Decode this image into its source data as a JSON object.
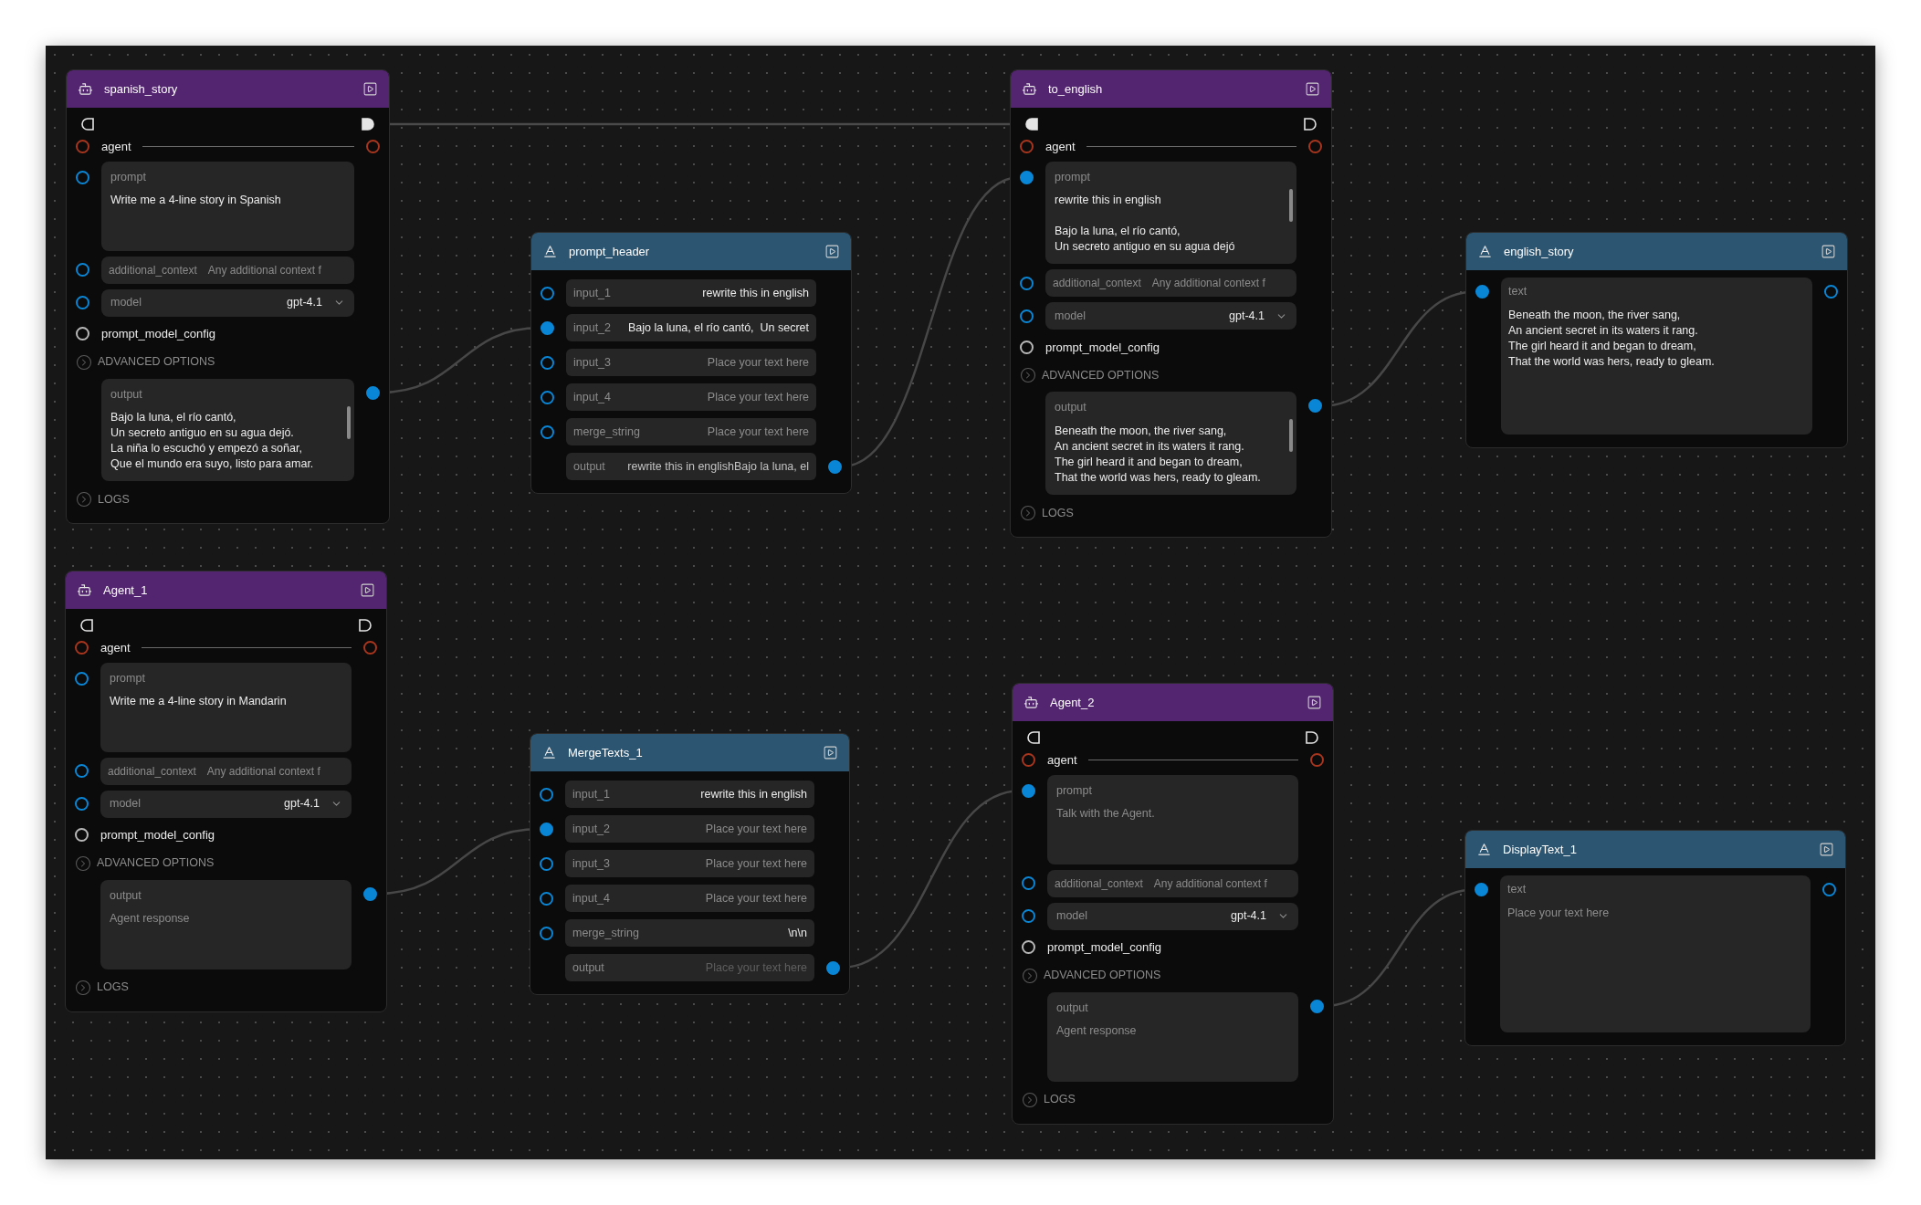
{
  "canvas": {
    "nodes": [
      {
        "kind": "agent",
        "title": "spanish_story",
        "flow_in": {
          "connected": false
        },
        "flow_out": {
          "connected": true
        },
        "agent": {
          "label": "agent",
          "in_connected": false,
          "out_connected": false
        },
        "prompt": {
          "label": "prompt",
          "lines": [
            "Write me a 4-line story in Spanish"
          ],
          "connected": false
        },
        "additional_context": {
          "label": "additional_context",
          "placeholder": "Any additional context f",
          "connected": false
        },
        "model": {
          "label": "model",
          "value": "gpt-4.1",
          "connected": false
        },
        "config": {
          "label": "prompt_model_config",
          "connected": false
        },
        "advanced": "ADVANCED OPTIONS",
        "output": {
          "label": "output",
          "lines": [
            "Bajo la luna, el río cantó,",
            "Un secreto antiguo en su agua dejó.",
            "La niña lo escuchó y empezó a soñar,",
            "Que el mundo era suyo, listo para amar."
          ],
          "connected": true
        },
        "logs": "LOGS"
      },
      {
        "kind": "merge",
        "title": "prompt_header",
        "fields": [
          {
            "label": "input_1",
            "value": "rewrite this in english",
            "connected": false
          },
          {
            "label": "input_2",
            "value": "Bajo la luna, el río cantó,  Un secret",
            "connected": true
          },
          {
            "label": "input_3",
            "placeholder": "Place your text here",
            "connected": false
          },
          {
            "label": "input_4",
            "placeholder": "Place your text here",
            "connected": false
          },
          {
            "label": "merge_string",
            "placeholder": "Place your text here",
            "connected": false
          }
        ],
        "output": {
          "label": "output",
          "value": "rewrite this in englishBajo la luna, el",
          "connected": true
        }
      },
      {
        "kind": "agent",
        "title": "to_english",
        "flow_in": {
          "connected": true
        },
        "flow_out": {
          "connected": false
        },
        "agent": {
          "label": "agent",
          "in_connected": false,
          "out_connected": false
        },
        "prompt": {
          "label": "prompt",
          "paragraphs": [
            [
              "rewrite this in english"
            ],
            [
              "Bajo la luna, el río cantó,",
              "Un secreto antiguo en su agua dejó"
            ]
          ],
          "connected": true
        },
        "additional_context": {
          "label": "additional_context",
          "placeholder": "Any additional context f",
          "connected": false
        },
        "model": {
          "label": "model",
          "value": "gpt-4.1",
          "connected": false
        },
        "config": {
          "label": "prompt_model_config",
          "connected": false
        },
        "advanced": "ADVANCED OPTIONS",
        "output": {
          "label": "output",
          "lines": [
            "Beneath the moon, the river sang,",
            "An ancient secret in its waters it rang.",
            "The girl heard it and began to dream,",
            "That the world was hers, ready to gleam."
          ],
          "connected": true
        },
        "logs": "LOGS"
      },
      {
        "kind": "display",
        "title": "english_story",
        "text": {
          "label": "text",
          "lines": [
            "Beneath the moon, the river sang,",
            "An ancient secret in its waters it rang.",
            "The girl heard it and began to dream,",
            "That the world was hers, ready to gleam."
          ],
          "in_connected": true,
          "out_connected": false
        }
      },
      {
        "kind": "agent",
        "title": "Agent_1",
        "flow_in": {
          "connected": false
        },
        "flow_out": {
          "connected": false
        },
        "agent": {
          "label": "agent",
          "in_connected": false,
          "out_connected": false
        },
        "prompt": {
          "label": "prompt",
          "lines": [
            "Write me a 4-line story in Mandarin"
          ],
          "connected": false
        },
        "additional_context": {
          "label": "additional_context",
          "placeholder": "Any additional context f",
          "connected": false
        },
        "model": {
          "label": "model",
          "value": "gpt-4.1",
          "connected": false
        },
        "config": {
          "label": "prompt_model_config",
          "connected": false
        },
        "advanced": "ADVANCED OPTIONS",
        "output": {
          "label": "output",
          "placeholder": "Agent response",
          "connected": true
        },
        "logs": "LOGS"
      },
      {
        "kind": "merge",
        "title": "MergeTexts_1",
        "fields": [
          {
            "label": "input_1",
            "value": "rewrite this in english",
            "connected": false
          },
          {
            "label": "input_2",
            "placeholder": "Place your text here",
            "connected": true
          },
          {
            "label": "input_3",
            "placeholder": "Place your text here",
            "connected": false
          },
          {
            "label": "input_4",
            "placeholder": "Place your text here",
            "connected": false
          },
          {
            "label": "merge_string",
            "value": "\\n\\n",
            "connected": false
          }
        ],
        "output": {
          "label": "output",
          "placeholder": "Place your text here",
          "connected": true
        }
      },
      {
        "kind": "agent",
        "title": "Agent_2",
        "flow_in": {
          "connected": false
        },
        "flow_out": {
          "connected": false
        },
        "agent": {
          "label": "agent",
          "in_connected": false,
          "out_connected": false
        },
        "prompt": {
          "label": "prompt",
          "placeholder": "Talk with the Agent.",
          "connected": true
        },
        "additional_context": {
          "label": "additional_context",
          "placeholder": "Any additional context f",
          "connected": false
        },
        "model": {
          "label": "model",
          "value": "gpt-4.1",
          "connected": false
        },
        "config": {
          "label": "prompt_model_config",
          "connected": false
        },
        "advanced": "ADVANCED OPTIONS",
        "output": {
          "label": "output",
          "placeholder": "Agent response",
          "connected": true
        },
        "logs": "LOGS"
      },
      {
        "kind": "display",
        "title": "DisplayText_1",
        "text": {
          "label": "text",
          "placeholder": "Place your text here",
          "in_connected": true,
          "out_connected": false
        }
      }
    ]
  }
}
